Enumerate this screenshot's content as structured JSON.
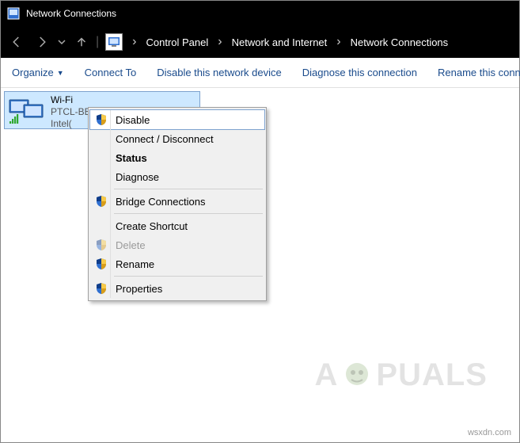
{
  "title": "Network Connections",
  "breadcrumbs": [
    "Control Panel",
    "Network and Internet",
    "Network Connections"
  ],
  "commands": {
    "organize": "Organize",
    "connect": "Connect To",
    "disable": "Disable this network device",
    "diagnose": "Diagnose this connection",
    "rename": "Rename this conne"
  },
  "connection": {
    "name": "Wi-Fi",
    "ssid": "PTCL-BB",
    "adapter_prefix": "Intel("
  },
  "context_menu": {
    "disable": "Disable",
    "connect": "Connect / Disconnect",
    "status": "Status",
    "diagnose": "Diagnose",
    "bridge": "Bridge Connections",
    "shortcut": "Create Shortcut",
    "delete": "Delete",
    "rename": "Rename",
    "properties": "Properties"
  },
  "watermark": {
    "pre": "A",
    "post": "PUALS"
  },
  "site": "wsxdn.com"
}
